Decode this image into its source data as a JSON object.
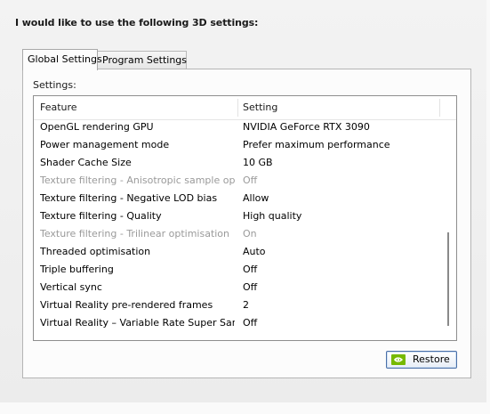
{
  "heading": "I would like to use the following 3D settings:",
  "tabs": [
    {
      "label": "Global Settings",
      "active": true
    },
    {
      "label": "Program Settings",
      "active": false
    }
  ],
  "settings_label": "Settings:",
  "columns": {
    "feature": "Feature",
    "setting": "Setting"
  },
  "rows": [
    {
      "feature": "OpenGL rendering GPU",
      "setting": "NVIDIA GeForce RTX 3090",
      "disabled": false
    },
    {
      "feature": "Power management mode",
      "setting": "Prefer maximum performance",
      "disabled": false
    },
    {
      "feature": "Shader Cache Size",
      "setting": "10 GB",
      "disabled": false
    },
    {
      "feature": "Texture filtering - Anisotropic sample opti...",
      "setting": "Off",
      "disabled": true
    },
    {
      "feature": "Texture filtering - Negative LOD bias",
      "setting": "Allow",
      "disabled": false
    },
    {
      "feature": "Texture filtering - Quality",
      "setting": "High quality",
      "disabled": false
    },
    {
      "feature": "Texture filtering - Trilinear optimisation",
      "setting": "On",
      "disabled": true
    },
    {
      "feature": "Threaded optimisation",
      "setting": "Auto",
      "disabled": false
    },
    {
      "feature": "Triple buffering",
      "setting": "Off",
      "disabled": false
    },
    {
      "feature": "Vertical sync",
      "setting": "Off",
      "disabled": false
    },
    {
      "feature": "Virtual Reality pre-rendered frames",
      "setting": "2",
      "disabled": false
    },
    {
      "feature": "Virtual Reality – Variable Rate Super Samp...",
      "setting": "Off",
      "disabled": false
    }
  ],
  "restore_button": {
    "label": "Restore",
    "icon": "nvidia-logo-icon"
  },
  "colors": {
    "disabled_text": "#9a9a9a",
    "button_border": "#4a6fa8",
    "nvidia_green": "#76b900"
  }
}
